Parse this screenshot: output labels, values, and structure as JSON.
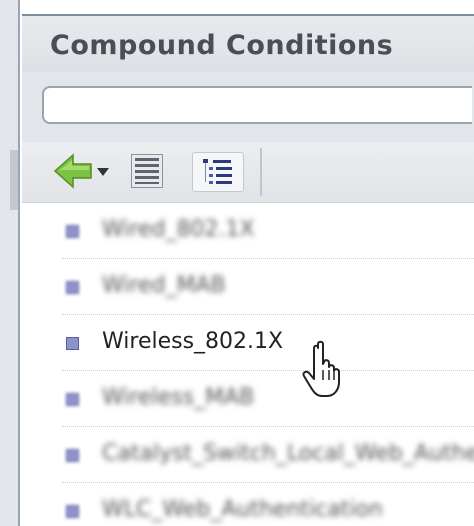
{
  "panel": {
    "title": "Compound Conditions"
  },
  "search": {
    "value": "",
    "placeholder": ""
  },
  "toolbar": {
    "back_icon": "green-left-arrow-icon",
    "list_icon": "list-view-icon",
    "tree_icon": "tree-view-icon"
  },
  "conditions": {
    "items": [
      {
        "label": "Wired_802.1X",
        "blurred": true
      },
      {
        "label": "Wired_MAB",
        "blurred": true
      },
      {
        "label": "Wireless_802.1X",
        "blurred": false
      },
      {
        "label": "Wireless_MAB",
        "blurred": true
      },
      {
        "label": "Catalyst_Switch_Local_Web_Authentication",
        "blurred": true
      },
      {
        "label": "WLC_Web_Authentication",
        "blurred": true
      }
    ]
  },
  "colors": {
    "bullet": "#8e92cc",
    "back_arrow": "#7cc242",
    "header_text": "#4a4f57"
  }
}
